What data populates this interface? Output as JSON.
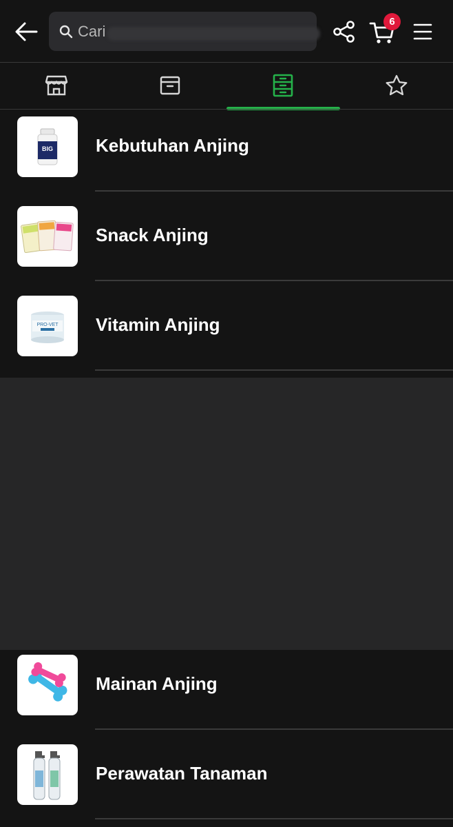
{
  "header": {
    "back_icon": "arrow-left-icon",
    "search": {
      "value": "Cari",
      "placeholder": "Cari",
      "icon": "search-icon"
    },
    "share_icon": "share-icon",
    "cart": {
      "icon": "cart-icon",
      "badge_count": "6",
      "badge_color": "#e0193b"
    },
    "menu_icon": "hamburger-menu-icon"
  },
  "tabs": [
    {
      "icon": "store-icon",
      "active": false
    },
    {
      "icon": "box-icon",
      "active": false
    },
    {
      "icon": "category-drawer-icon",
      "active": true
    },
    {
      "icon": "star-icon",
      "active": false
    }
  ],
  "accent_color": "#25b24a",
  "categories": [
    {
      "label": "Kebutuhan Anjing",
      "thumb": "supplement-bottle-image"
    },
    {
      "label": "Snack Anjing",
      "thumb": "snack-packs-image"
    },
    {
      "label": "Vitamin Anjing",
      "thumb": "vitamin-jar-image"
    },
    {
      "label": "Mainan Anjing",
      "thumb": "bone-toys-image"
    },
    {
      "label": "Perawatan Tanaman",
      "thumb": "spray-bottles-image"
    }
  ]
}
